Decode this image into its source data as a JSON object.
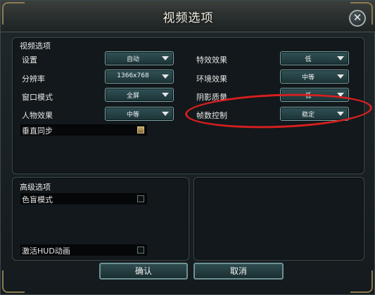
{
  "window": {
    "title": "视频选项"
  },
  "video_section": {
    "label": "视频选项",
    "left_options": [
      {
        "label": "设置",
        "value": "自动"
      },
      {
        "label": "分辨率",
        "value": "1366x768"
      },
      {
        "label": "窗口模式",
        "value": "全屏"
      },
      {
        "label": "人物效果",
        "value": "中等"
      }
    ],
    "right_options": [
      {
        "label": "特效效果",
        "value": "低"
      },
      {
        "label": "环境效果",
        "value": "中等"
      },
      {
        "label": "阴影质量",
        "value": "低"
      },
      {
        "label": "帧数控制",
        "value": "稳定"
      }
    ],
    "vsync": {
      "label": "垂直同步",
      "checked": true
    }
  },
  "advanced_section": {
    "label": "高级选项",
    "colorblind": {
      "label": "色盲模式",
      "checked": false
    },
    "hud_anim": {
      "label": "激活HUD动画",
      "checked": false
    }
  },
  "footer": {
    "confirm_label": "确认",
    "cancel_label": "取消"
  },
  "annotation": {
    "color": "#d81f1f"
  }
}
